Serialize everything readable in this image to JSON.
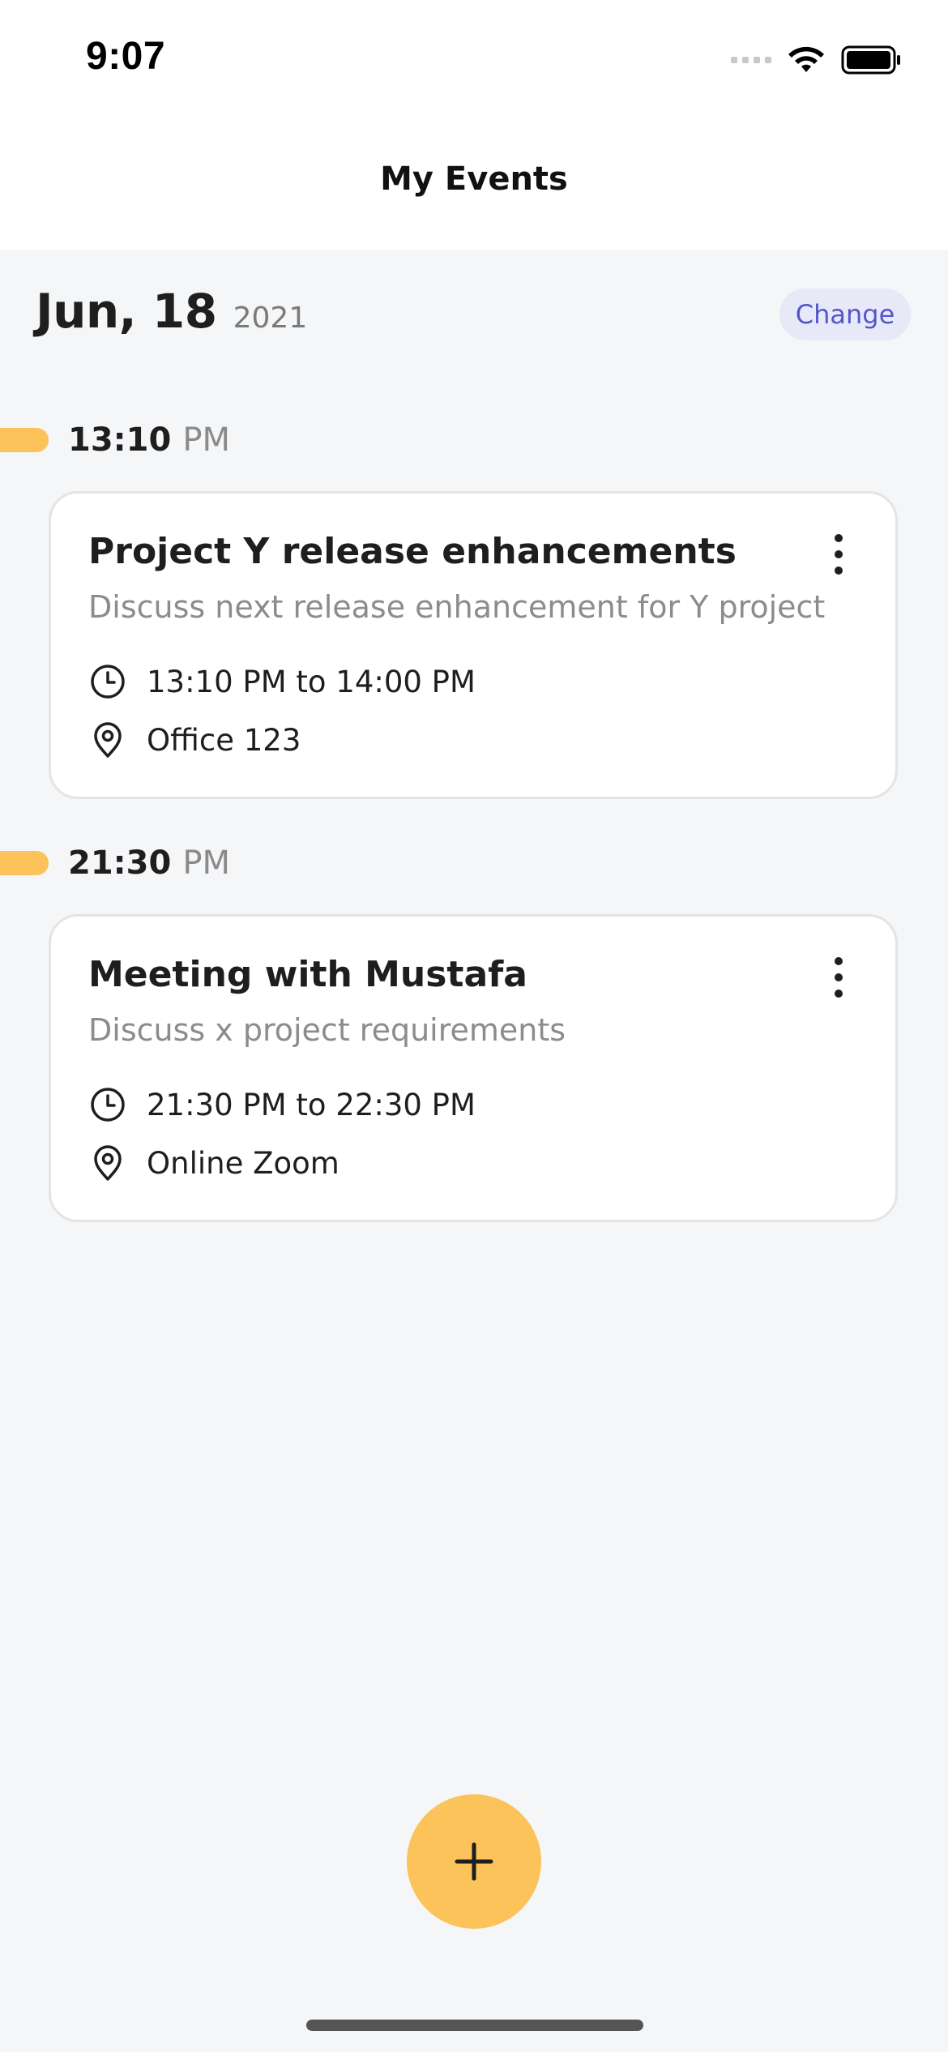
{
  "status_bar": {
    "time": "9:07"
  },
  "header": {
    "title": "My Events"
  },
  "date": {
    "day": "Jun, 18",
    "year": "2021",
    "change_label": "Change"
  },
  "events": [
    {
      "time": "13:10",
      "period": "PM",
      "title": "Project Y release enhancements",
      "description": "Discuss next release enhancement for Y project",
      "time_range": "13:10 PM to 14:00 PM",
      "location": "Office 123"
    },
    {
      "time": "21:30",
      "period": "PM",
      "title": "Meeting with Mustafa",
      "description": "Discuss x project requirements",
      "time_range": "21:30 PM to 22:30 PM",
      "location": "Online Zoom"
    }
  ],
  "icons": {
    "time_marker": "timeline-marker-icon",
    "more": "more-vertical-icon",
    "clock": "clock-icon",
    "location": "location-pin-icon",
    "add": "plus-icon"
  },
  "colors": {
    "accent": "#FBC35A",
    "change_bg": "#E7E8F8",
    "change_text": "#5457C8",
    "background": "#F5F6F8"
  }
}
